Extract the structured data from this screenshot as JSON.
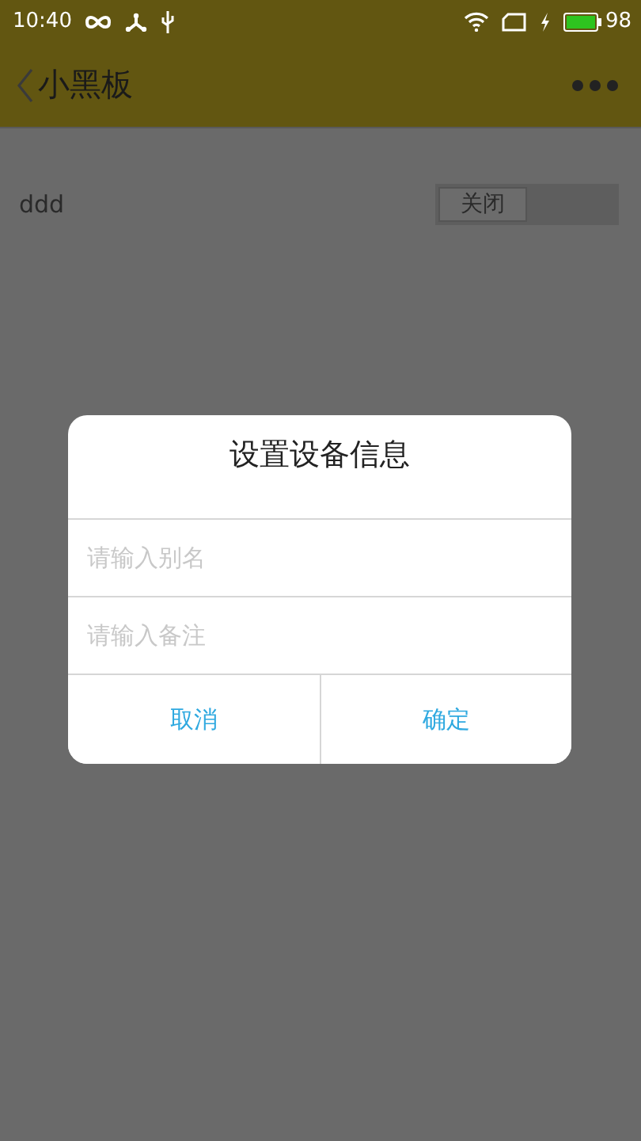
{
  "status_bar": {
    "time": "10:40",
    "battery": "98"
  },
  "toolbar": {
    "title": "小黑板"
  },
  "devices": [
    {
      "name": "ddd",
      "switch_label": "关闭",
      "on": false
    }
  ],
  "dialog": {
    "title": "设置设备信息",
    "fields": [
      {
        "placeholder": "请输入别名"
      },
      {
        "placeholder": "请输入备注"
      }
    ],
    "buttons": [
      "取消",
      "确定"
    ]
  }
}
